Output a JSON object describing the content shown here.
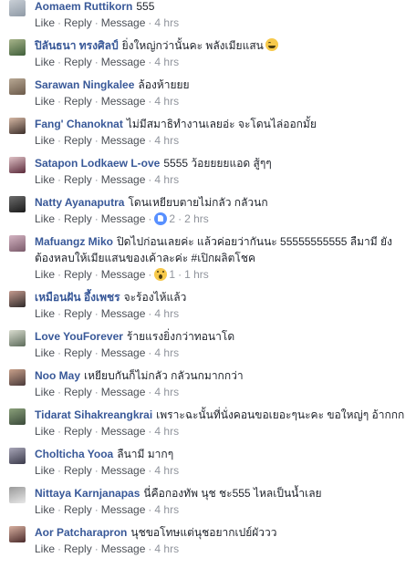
{
  "actions": {
    "like": "Like",
    "reply": "Reply",
    "message": "Message"
  },
  "comments": [
    {
      "author": "Aomaem Ruttikorn",
      "text": "555",
      "time": "4 hrs",
      "avatar": [
        "#8f9aa6",
        "#c9cfd6"
      ]
    },
    {
      "author": "ปิลันธนา ทรงศิลป์",
      "text": "ยิ่งใหญ่กว่านั้นคะ พลังเมียแสน",
      "emoji": "grinning-emoji",
      "time": "4 hrs",
      "avatar": [
        "#3f5f3a",
        "#a7b48a"
      ]
    },
    {
      "author": "Sarawan Ningkalee",
      "text": "ล้องห้ายยย",
      "time": "4 hrs",
      "avatar": [
        "#6b5a4a",
        "#b8a894"
      ]
    },
    {
      "author": "Fang' Chanoknat",
      "text": "ไม่มีสมาธิทำงานเลยอ่ะ จะโดนไล่ออกมั้ย",
      "time": "4 hrs",
      "avatar": [
        "#3b2e2a",
        "#d6b8a4"
      ]
    },
    {
      "author": "Satapon Lodkaew L-ove",
      "text": "5555 ว้อยยยยแอด สู้ๆๆ",
      "time": "4 hrs",
      "avatar": [
        "#5a2a3a",
        "#e0c2c6"
      ]
    },
    {
      "author": "Natty Ayanaputra",
      "text": "โดนเหยียบตายไม่กลัว กลัวนก",
      "time": "2 hrs",
      "reaction": {
        "type": "like",
        "count": "2"
      },
      "avatar": [
        "#1a1a1a",
        "#6d6d6d"
      ]
    },
    {
      "author": "Mafuangz Miko",
      "text": "ปิดไปก่อนเลยค่ะ แล้วค่อยว่ากันนะ 55555555555 ลืมามี ยังต้องหลบให้เมียแสนของเค้าละค่ะ #เปิกผลิตโชค",
      "time": "1 hrs",
      "reaction": {
        "type": "wow",
        "count": "1"
      },
      "avatar": [
        "#7a5a6a",
        "#d4b4c2"
      ]
    },
    {
      "author": "เหมือนฝัน อึ้งเพชร",
      "text": "จะร้องไห้แล้ว",
      "time": "4 hrs",
      "avatar": [
        "#2f2a2a",
        "#c49a8e"
      ]
    },
    {
      "author": "Love YouForever",
      "text": "ร้ายแรงยิ่งกว่าทอนาโด",
      "time": "4 hrs",
      "avatar": [
        "#5c6b5a",
        "#d9dccf"
      ]
    },
    {
      "author": "Noo May",
      "text": "เหยียบกันก็ไม่กลัว กลัวนกมากกว่า",
      "time": "4 hrs",
      "avatar": [
        "#4a3a3a",
        "#c8a08a"
      ]
    },
    {
      "author": "Tidarat Sihakreangkrai",
      "text": "เพราะฉะนั้นที่นั่งคอนขอเยอะๆนะคะ ขอใหญ่ๆ อ้ากกก",
      "time": "4 hrs",
      "avatar": [
        "#3a4a3a",
        "#8aa07a"
      ]
    },
    {
      "author": "Cholticha Yooa",
      "text": "ลืนามี มากๆ",
      "time": "4 hrs",
      "avatar": [
        "#3a3a4a",
        "#a8a6b8"
      ]
    },
    {
      "author": "Nittaya Karnjanapas",
      "text": "นี่คือกองทัพ นุช ชะ555 ไหลเป็นน้ำเลย",
      "time": "4 hrs",
      "avatar": [
        "#e8e8e8",
        "#9a9a9a"
      ]
    },
    {
      "author": "Aor Patcharapron",
      "text": "นุชขอโทษแต่นุชอยากเปย์ผัววว",
      "time": "4 hrs",
      "avatar": [
        "#4a2a2a",
        "#d8b0a0"
      ]
    }
  ]
}
